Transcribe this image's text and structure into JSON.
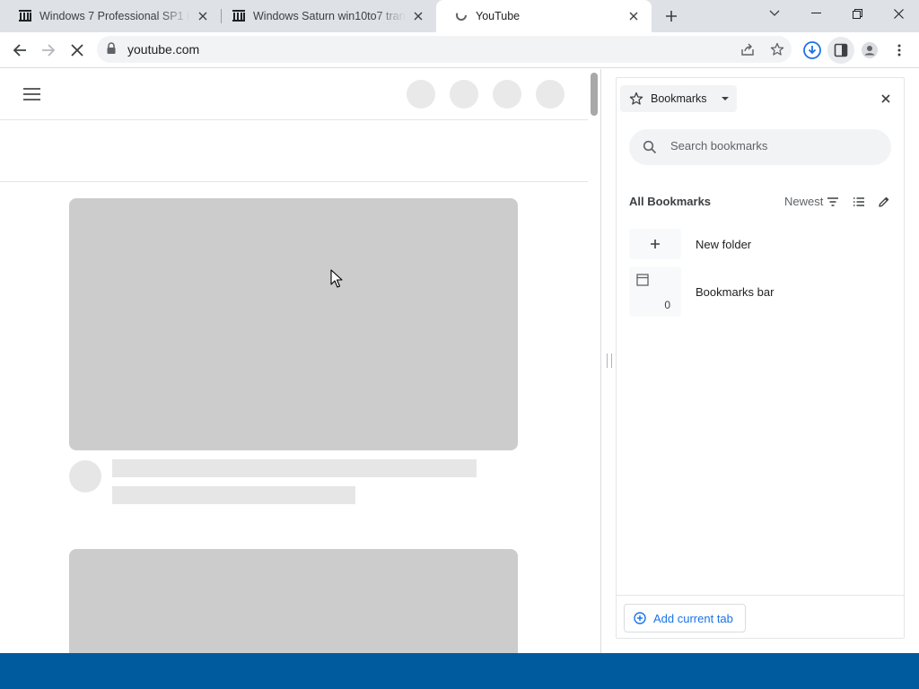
{
  "browser": {
    "tabs": [
      {
        "title": "Windows 7 Professional SP1 (32",
        "icon": "archive-icon"
      },
      {
        "title": "Windows Saturn win10to7 transf",
        "icon": "archive-icon"
      },
      {
        "title": "YouTube",
        "icon": "loading-icon",
        "active": true
      }
    ],
    "url": "youtube.com"
  },
  "bookmarks_panel": {
    "selector_label": "Bookmarks",
    "search_placeholder": "Search bookmarks",
    "section_title": "All Bookmarks",
    "sort_label": "Newest",
    "items": [
      {
        "label": "New folder",
        "icon": "plus-icon"
      },
      {
        "label": "Bookmarks bar",
        "icon": "folder-icon",
        "count": "0"
      }
    ],
    "add_current_tab_label": "Add current tab"
  },
  "colors": {
    "tab_strip": "#dee1e6",
    "taskbar": "#005a9e",
    "accent": "#1a73e8",
    "skeleton_thumb": "#cccccc",
    "skeleton_line": "#e6e6e6"
  }
}
